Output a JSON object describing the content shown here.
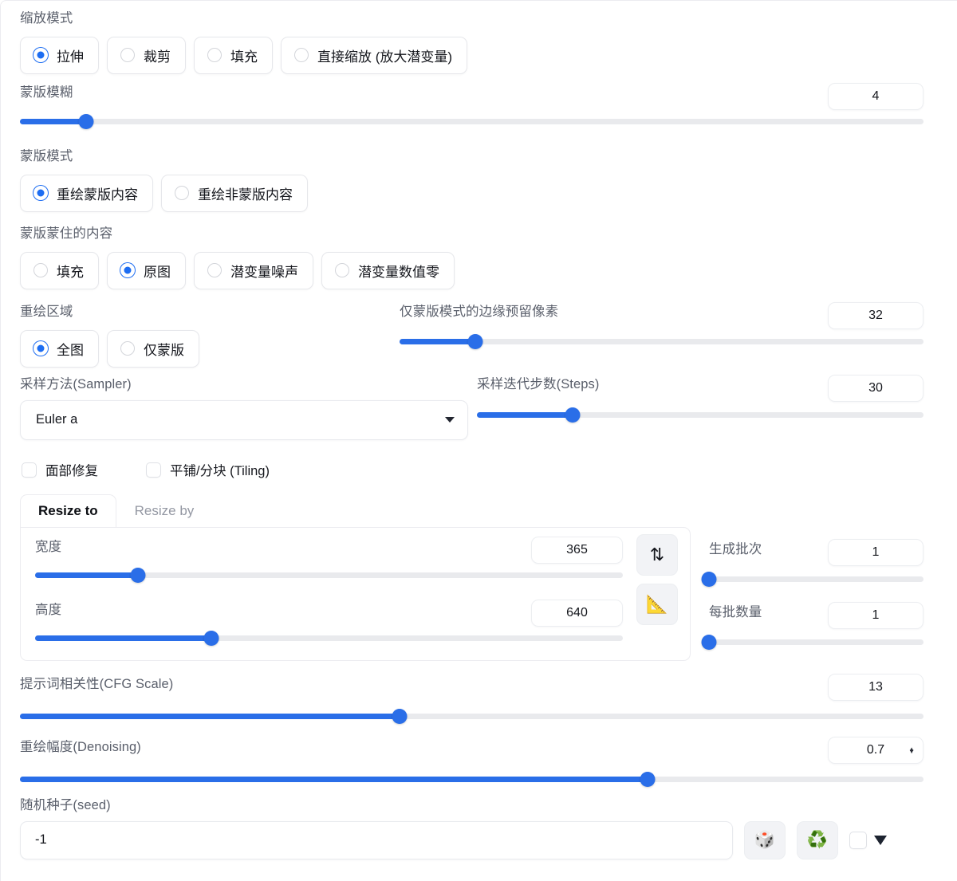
{
  "resize_mode": {
    "label": "缩放模式",
    "options": [
      {
        "label": "拉伸",
        "selected": true
      },
      {
        "label": "裁剪",
        "selected": false
      },
      {
        "label": "填充",
        "selected": false
      },
      {
        "label": "直接缩放 (放大潜变量)",
        "selected": false
      }
    ]
  },
  "mask_blur": {
    "label": "蒙版模糊",
    "value": "4",
    "percent": 7.3
  },
  "mask_mode": {
    "label": "蒙版模式",
    "options": [
      {
        "label": "重绘蒙版内容",
        "selected": true
      },
      {
        "label": "重绘非蒙版内容",
        "selected": false
      }
    ]
  },
  "masked_content": {
    "label": "蒙版蒙住的内容",
    "options": [
      {
        "label": "填充",
        "selected": false
      },
      {
        "label": "原图",
        "selected": true
      },
      {
        "label": "潜变量噪声",
        "selected": false
      },
      {
        "label": "潜变量数值零",
        "selected": false
      }
    ]
  },
  "inpaint_area": {
    "label": "重绘区域",
    "options": [
      {
        "label": "全图",
        "selected": true
      },
      {
        "label": "仅蒙版",
        "selected": false
      }
    ]
  },
  "only_masked_padding": {
    "label": "仅蒙版模式的边缘预留像素",
    "value": "32",
    "percent": 14.5
  },
  "sampler": {
    "label": "采样方法(Sampler)",
    "value": "Euler a"
  },
  "steps": {
    "label": "采样迭代步数(Steps)",
    "value": "30",
    "percent": 21.5
  },
  "checkboxes": [
    {
      "label": "面部修复",
      "checked": false
    },
    {
      "label": "平铺/分块 (Tiling)",
      "checked": false
    }
  ],
  "resize_tabs": [
    {
      "label": "Resize to",
      "active": true
    },
    {
      "label": "Resize by",
      "active": false
    }
  ],
  "width": {
    "label": "宽度",
    "value": "365",
    "percent": 17.5
  },
  "height": {
    "label": "高度",
    "value": "640",
    "percent": 30.0
  },
  "swap_button": {
    "icon": "swap-vertical-arrows-icon",
    "glyph": "⇅"
  },
  "ratio_button": {
    "icon": "triangle-ruler-icon",
    "glyph": "📐"
  },
  "batch_count": {
    "label": "生成批次",
    "value": "1",
    "percent": 0
  },
  "batch_size": {
    "label": "每批数量",
    "value": "1",
    "percent": 0
  },
  "cfg_scale": {
    "label": "提示词相关性(CFG Scale)",
    "value": "13",
    "percent": 42.0
  },
  "denoising": {
    "label": "重绘幅度(Denoising)",
    "value": "0.7",
    "percent": 69.5
  },
  "seed": {
    "label": "随机种子(seed)",
    "value": "-1",
    "dice_glyph": "🎲",
    "recycle_glyph": "♻️",
    "extra_checked": false
  },
  "colors": {
    "accent": "#2a6ee8",
    "radio_accent": "#1d6df2",
    "track": "#e9eaed",
    "label": "#5a5f6b",
    "border": "#ececf0"
  }
}
